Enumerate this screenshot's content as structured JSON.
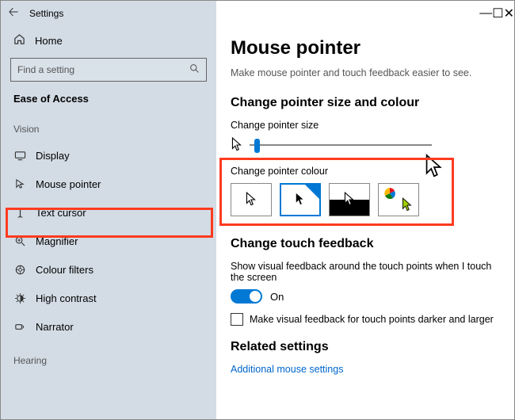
{
  "window": {
    "title": "Settings",
    "buttons": {
      "min": "—",
      "max": "☐",
      "close": "✕"
    }
  },
  "sidebar": {
    "home_label": "Home",
    "search_placeholder": "Find a setting",
    "category": "Ease of Access",
    "groups": {
      "vision": "Vision",
      "hearing": "Hearing"
    },
    "items": {
      "display": "Display",
      "mouse_pointer": "Mouse pointer",
      "text_cursor": "Text cursor",
      "magnifier": "Magnifier",
      "colour_filters": "Colour filters",
      "high_contrast": "High contrast",
      "narrator": "Narrator"
    }
  },
  "main": {
    "title": "Mouse pointer",
    "subtitle": "Make mouse pointer and touch feedback easier to see.",
    "section_size_colour": "Change pointer size and colour",
    "label_size": "Change pointer size",
    "label_colour": "Change pointer colour",
    "section_touch": "Change touch feedback",
    "touch_desc": "Show visual feedback around the touch points when I touch the screen",
    "toggle_state": "On",
    "checkbox_label": "Make visual feedback for touch points darker and larger",
    "section_related": "Related settings",
    "link_additional": "Additional mouse settings"
  }
}
